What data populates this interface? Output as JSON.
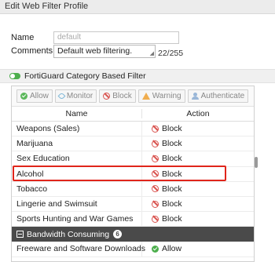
{
  "window": {
    "title": "Edit Web Filter Profile"
  },
  "form": {
    "name_label": "Name",
    "name_placeholder": "default",
    "comments_label": "Comments",
    "comments_value": "Default web filtering.",
    "char_count": "22/255"
  },
  "section": {
    "label": "FortiGuard Category Based Filter",
    "enabled": true
  },
  "toolbar": {
    "allow": "Allow",
    "monitor": "Monitor",
    "block": "Block",
    "warning": "Warning",
    "authenticate": "Authenticate"
  },
  "table": {
    "columns": [
      "Name",
      "Action"
    ],
    "rows": [
      {
        "name": "Weapons (Sales)",
        "action": "Block"
      },
      {
        "name": "Marijuana",
        "action": "Block"
      },
      {
        "name": "Sex Education",
        "action": "Block"
      },
      {
        "name": "Alcohol",
        "action": "Block"
      },
      {
        "name": "Tobacco",
        "action": "Block"
      },
      {
        "name": "Lingerie and Swimsuit",
        "action": "Block"
      },
      {
        "name": "Sports Hunting and War Games",
        "action": "Block"
      }
    ],
    "group": {
      "label": "Bandwidth Consuming",
      "count": "6"
    },
    "group_rows": [
      {
        "name": "Freeware and Software Downloads",
        "action": "Allow"
      }
    ]
  },
  "colors": {
    "block": "#d9534f",
    "allow": "#4cae4c",
    "group_bg": "#4a4a4a",
    "highlight": "#e0251b"
  }
}
